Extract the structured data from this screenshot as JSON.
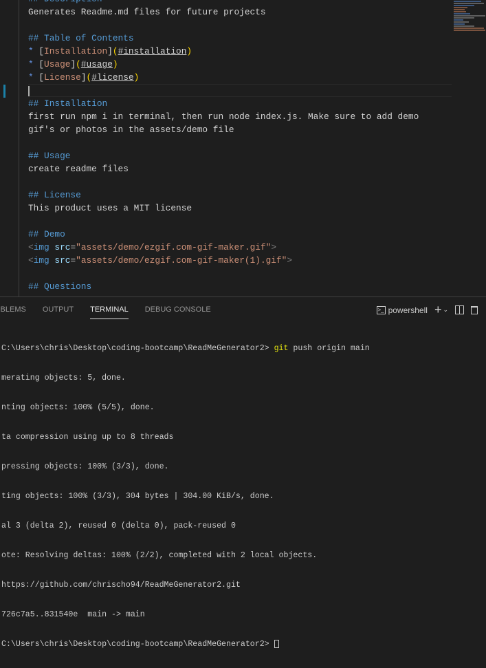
{
  "editor": {
    "lines": {
      "desc_heading": "## Description",
      "desc": "Generates Readme.md files for future projects",
      "toc_heading": "## Table of Contents",
      "toc": [
        {
          "label": "Installation",
          "anchor": "#installation"
        },
        {
          "label": "Usage",
          "anchor": "#usage"
        },
        {
          "label": "License",
          "anchor": "#license"
        }
      ],
      "install_heading": "## Installation",
      "install1": "first run npm i in terminal, then run node index.js. Make sure to add demo",
      "install2": "gif's or photos in the assets/demo file",
      "usage_heading": "## Usage",
      "usage": "create readme files",
      "license_heading": "## License",
      "license": "This product uses a MIT license",
      "demo_heading": "## Demo",
      "img1_src": "assets/demo/ezgif.com-gif-maker.gif",
      "img2_src": "assets/demo/ezgif.com-gif-maker(1).gif",
      "questions_heading": "## Questions"
    }
  },
  "panel": {
    "tabs": [
      "OBLEMS",
      "OUTPUT",
      "TERMINAL",
      "DEBUG CONSOLE"
    ],
    "shell": "powershell",
    "terminal": {
      "prompt": "C:\\Users\\chris\\Desktop\\coding-bootcamp\\ReadMeGenerator2> ",
      "cmd_git": "git",
      "cmd_rest": " push origin main",
      "output": [
        "merating objects: 5, done.",
        "nting objects: 100% (5/5), done.",
        "ta compression using up to 8 threads",
        "pressing objects: 100% (3/3), done.",
        "ting objects: 100% (3/3), 304 bytes | 304.00 KiB/s, done.",
        "al 3 (delta 2), reused 0 (delta 0), pack-reused 0",
        "ote: Resolving deltas: 100% (2/2), completed with 2 local objects.",
        "https://github.com/chrischo94/ReadMeGenerator2.git",
        "726c7a5..831540e  main -> main"
      ],
      "last_prompt": "C:\\Users\\chris\\Desktop\\coding-bootcamp\\ReadMeGenerator2> "
    }
  }
}
